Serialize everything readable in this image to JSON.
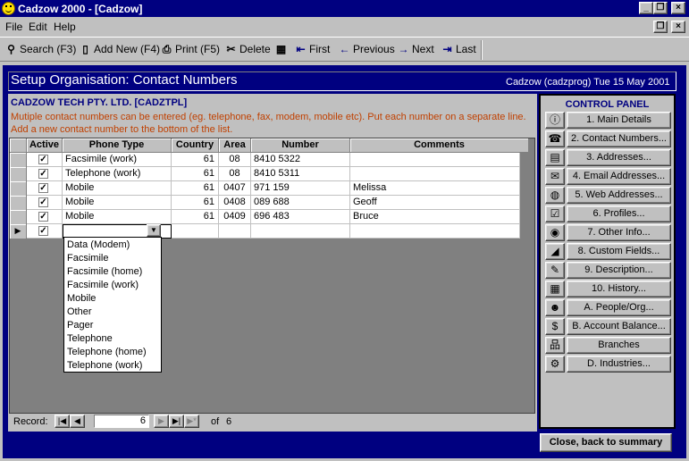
{
  "window": {
    "title": "Cadzow 2000 - [Cadzow]"
  },
  "menu": {
    "items": [
      "File",
      "Edit",
      "Help"
    ]
  },
  "toolbar": {
    "search": "Search (F3)",
    "add_new": "Add New (F4)",
    "print": "Print (F5)",
    "delete": "Delete",
    "first": "First",
    "previous": "Previous",
    "next": "Next",
    "last": "Last"
  },
  "header": {
    "title": "Setup Organisation: Contact Numbers",
    "user_info": "Cadzow (cadzprog) Tue 15 May 2001"
  },
  "org": {
    "name": "CADZOW TECH PTY. LTD.  [CADZTPL]"
  },
  "notes": [
    "Mutiple contact numbers can be entered (eg. telephone, fax, modem, mobile etc). Put each number on a separate line.",
    "Add a new contact number to the bottom of the list."
  ],
  "grid": {
    "columns": [
      "Active",
      "Phone Type",
      "Country",
      "Area",
      "Number",
      "Comments"
    ],
    "rows": [
      {
        "active": true,
        "type": "Facsimile (work)",
        "country": "61",
        "area": "08",
        "number": "8410 5322",
        "comments": ""
      },
      {
        "active": true,
        "type": "Telephone (work)",
        "country": "61",
        "area": "08",
        "number": "8410 5311",
        "comments": ""
      },
      {
        "active": true,
        "type": "Mobile",
        "country": "61",
        "area": "0407",
        "number": "971 159",
        "comments": "Melissa"
      },
      {
        "active": true,
        "type": "Mobile",
        "country": "61",
        "area": "0408",
        "number": "089 688",
        "comments": "Geoff"
      },
      {
        "active": true,
        "type": "Mobile",
        "country": "61",
        "area": "0409",
        "number": "696 483",
        "comments": "Bruce"
      }
    ]
  },
  "dropdown": {
    "options": [
      "Data (Modem)",
      "Facsimile",
      "Facsimile (home)",
      "Facsimile (work)",
      "Mobile",
      "Other",
      "Pager",
      "Telephone",
      "Telephone (home)",
      "Telephone (work)"
    ]
  },
  "record_nav": {
    "label": "Record:",
    "current": "6",
    "of_label": "of",
    "total": "6"
  },
  "control_panel": {
    "title": "CONTROL PANEL",
    "buttons": [
      {
        "label": "1. Main Details",
        "icon": "info-icon"
      },
      {
        "label": "2. Contact Numbers...",
        "icon": "phone-icon"
      },
      {
        "label": "3. Addresses...",
        "icon": "address-card-icon"
      },
      {
        "label": "4. Email Addresses...",
        "icon": "email-icon"
      },
      {
        "label": "5. Web Addresses...",
        "icon": "globe-icon"
      },
      {
        "label": "6. Profiles...",
        "icon": "profile-icon"
      },
      {
        "label": "7. Other Info...",
        "icon": "other-info-icon"
      },
      {
        "label": "8. Custom Fields...",
        "icon": "custom-fields-icon"
      },
      {
        "label": "9. Description...",
        "icon": "description-icon"
      },
      {
        "label": "10. History...",
        "icon": "history-icon"
      },
      {
        "label": "A. People/Org...",
        "icon": "people-icon"
      },
      {
        "label": "B. Account Balance...",
        "icon": "dollar-icon"
      },
      {
        "label": "Branches",
        "icon": "branches-icon"
      },
      {
        "label": "D. Industries...",
        "icon": "industries-icon"
      }
    ]
  },
  "footer": {
    "close_label": "Close, back to summary"
  }
}
